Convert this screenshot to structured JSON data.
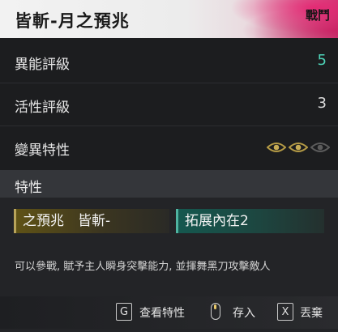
{
  "header": {
    "title": "皆斬-月之預兆",
    "tag": "戰鬥"
  },
  "stats": [
    {
      "label": "異能評級",
      "value": "5",
      "color": "#4ed4b8"
    },
    {
      "label": "活性評級",
      "value": "3",
      "color": "#dcdcdc"
    },
    {
      "label": "變異特性",
      "eyes": {
        "active": 2,
        "total": 3
      }
    }
  ],
  "traits_section": {
    "heading": "特性",
    "traits": [
      {
        "label": "之預兆　皆斬-",
        "color": "#b7a35a"
      },
      {
        "label": "拓展內在2",
        "color": "#4fb3a0"
      }
    ],
    "description": "可以參戰, 賦予主人瞬身突擊能力, 並揮舞黑刀攻擊敵人"
  },
  "footer": {
    "inspect": {
      "key": "G",
      "label": "查看特性"
    },
    "store": {
      "icon": "mouse-icon",
      "label": "存入"
    },
    "discard": {
      "key": "X",
      "label": "丟棄"
    }
  }
}
